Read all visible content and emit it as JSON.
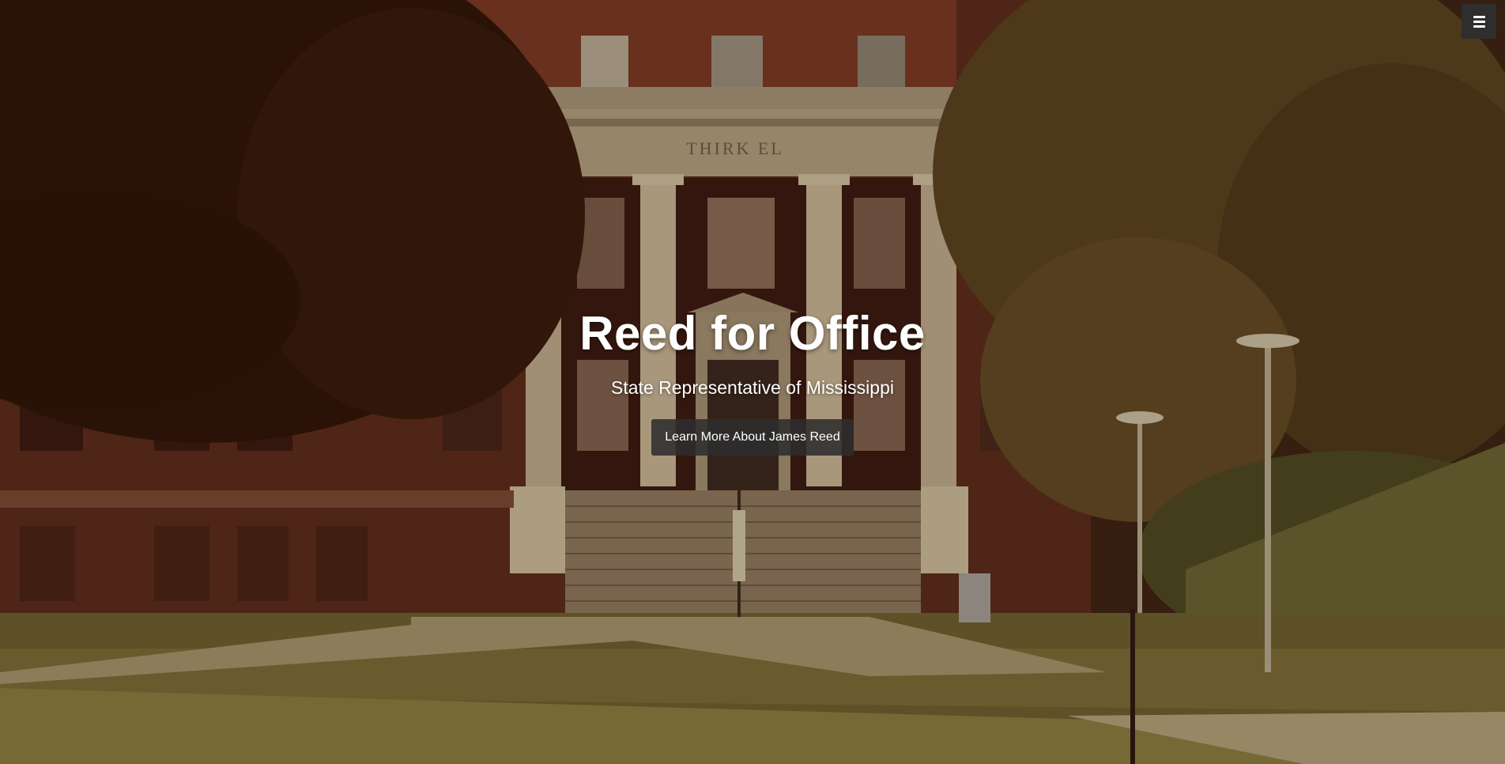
{
  "hero": {
    "title": "Reed for Office",
    "subtitle": "State Representative of Mississippi",
    "cta_label": "Learn More About James Reed",
    "building_inscription": "THIRK EL"
  },
  "nav": {
    "menu_icon": "hamburger-menu-icon"
  },
  "colors": {
    "button_bg": "#2e2e2e",
    "text": "#ffffff",
    "photo_tone": "#4a2a18"
  }
}
